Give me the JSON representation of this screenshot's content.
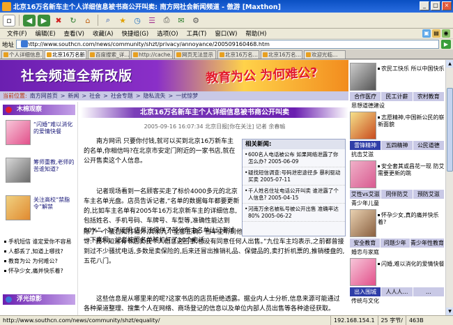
{
  "window": {
    "title": "北京16万名新车主个人详细信息被书商公开叫卖: 南方网社会新闻频道 - 傲游 [Maxthon]",
    "min_label": "_",
    "max_label": "□",
    "close_label": "×"
  },
  "menu": {
    "items": [
      "文件(F)",
      "编辑(E)",
      "查看(V)",
      "收藏(A)",
      "快捷组(G)",
      "选项(O)",
      "工具(T)",
      "窗口(W)",
      "帮助(H)"
    ]
  },
  "address": {
    "label": "地址",
    "url": "http://www.southcn.com/news/community/shzt/privacy/annoyance/200509160468.htm",
    "go_label": "▶"
  },
  "tabs": [
    "个人详细信息…",
    "北京16万名新…",
    "百度搜索_详…",
    "http://cache…",
    "网页无法显示",
    "北京16万名…",
    "北京16万名…",
    "欢迎光临…"
  ],
  "banner": {
    "title": "社会频道全新改版",
    "slogan": "教育为公 为何难公?"
  },
  "nav": {
    "prefix": "当前位置:",
    "crumbs": [
      "南方网首页",
      "新闻",
      "社会",
      "社会专题",
      "隐私流失",
      "一扰惊梦"
    ],
    "sep": ">"
  },
  "left": {
    "section_title": "木棉观察",
    "features": [
      {
        "text": "“闪婚”难以消化的爱情快餐"
      },
      {
        "text": "筹师重教,老师的苦谁知道?"
      },
      {
        "text": "关注高校“禁脂令”解禁"
      }
    ],
    "links": [
      "手机短信 谁定爱你不容易",
      "人都丢了,知道上哪找?",
      "教育为公 为何难公?",
      "怀孕少女,痛并快乐着?"
    ],
    "section2_title": "浮光掠影"
  },
  "article": {
    "title": "北京16万名新车主个人详细信息被书商公开叫卖",
    "meta": "2005-09-16 16:07:34 北京日报[你在关注] 记者 余春瑜",
    "para1": "南方网讯  只要你付钱,就可以买到北京16万新车主的名单,你相信吗?在北京市安定门附近的一家书店,就在公开售卖这个人信息。",
    "para2": "记者现场看到一名顾客买走了标价4000多元的北京车主名单光盘。店员告诉记者,“名单的数据每年都要更新的,比如车主名单有2005年16万北京新车主的详细信息,包括姓名、手机号码、车牌号、车型等,准确性能达到80%”。为了证明,店员还提供了部分车主名单让记者试一下真假。记者按照名单随机打了10个电话,",
    "para3": "除了一个被告知打错外,其余九个全部正确。当车主听到他们的信息被准确说出来时,都很惊讶:“我不知道有书店卖我个人信息这回事,也没有同意任何人出售。”九位车主均表示,之前都曾接到过不少骚扰电话,多数是卖保险的,后来还冒出推销礼品、保健品的,卖打折机票的,推销楼盘的,五花八门。",
    "para4": "这些信息是从哪里来的呢?这家书店的店员拒绝透露。据业内人士分析,信息来源可能通过各种渠道整理、搜集个人在网络、商场登记的信息以及单位内部人员出售等各种途径获取。"
  },
  "related": {
    "title": "相关新闻:",
    "items": [
      "600名人电话被公布 如果网络泄露了你怎么办? 2005-06-09",
      "疑找短信调查:号码泄密途径多 暴利驱动买卖 2005-07-11",
      "千人姓名住址电话公开叫卖 谁泄露了个人信息? 2005-04-15",
      "河南万余名被私号被公开出售 准确率达80% 2005-06-22"
    ]
  },
  "right": {
    "blocks": [
      {
        "text": "农民工快乐 所以中国快乐",
        "tags": [
          "合作医疗",
          "民工计薪",
          "农村教育"
        ],
        "sub": "思想道德建设"
      },
      {
        "text": "志愿精神,中国新公民的崭新面貌",
        "tags": [
          "雷锋精神",
          "五四精神",
          "公民道德"
        ],
        "sub": "抗击艾滋"
      },
      {
        "text": "安全套其或昌花一现 防艾需要更新的跳",
        "tags": [
          "艾性vs艾滋",
          "同伴防艾",
          "预防艾滋"
        ],
        "sub": "青少年儿童"
      },
      {
        "text": "怀孕少女,真的痛并快乐着?",
        "tags": [
          "安全教育",
          "问题少年",
          "青少年性教育"
        ],
        "sub": "婚恋与家庭"
      },
      {
        "text": "闪婚,难以消化的爱情快餐",
        "tags": [
          "出入围城",
          "人人人…",
          "…"
        ],
        "sub": "传统与文化"
      }
    ]
  },
  "status": {
    "url": "http://www.southcn.com/news/community/shzt/equality/",
    "ip": "192.168.154.1",
    "speed": "25 字节/",
    "size": "463B"
  }
}
